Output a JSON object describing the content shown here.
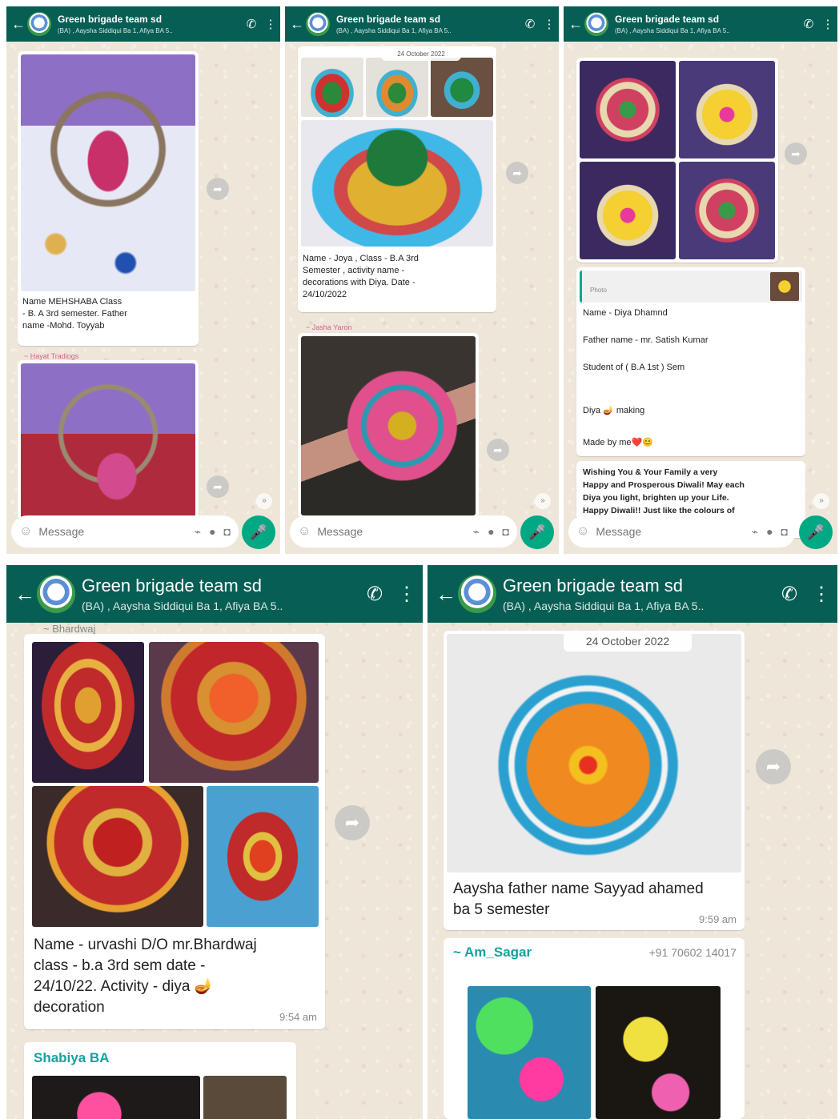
{
  "header": {
    "title": "Green brigade team sd",
    "subtitle": "(BA) , Aaysha Siddiqui Ba 1, Afiya BA 5.."
  },
  "input": {
    "placeholder": "Message"
  },
  "colors": {
    "header": "#075e54",
    "accent": "#00a884",
    "chat_bg": "#efe6da"
  },
  "icons": [
    "back-arrow-icon",
    "group-avatar",
    "call-icon",
    "menu-icon",
    "emoji-icon",
    "attach-icon",
    "payment-icon",
    "camera-icon",
    "mic-icon",
    "forward-icon"
  ],
  "panel1": {
    "caption": "Name MEHSHABA             Class\n- B. A 3rd semester.   Father\nname -Mohd. Toyyab",
    "sender": "~ Hayat Tradings"
  },
  "panel2": {
    "date": "24 October 2022",
    "caption": "Name - Joya , Class - B.A 3rd\nSemester , activity name -\ndecorations with Diya.          Date -\n24/10/2022",
    "sender": "~ Jasha Yaron"
  },
  "panel3": {
    "quote_label": "Photo",
    "lines": [
      "Name - Diya Dhamnd",
      "Father name - mr. Satish Kumar",
      "Student of ( B.A 1st ) Sem",
      "Diya 🪔 making",
      "Made by me❤️😊"
    ],
    "greeting": "Wishing You & Your Family a very\nHappy and Prosperous Diwali! May each\nDiya you light, brighten up your Life.\nHappy Diwali!! Just like the colours of"
  },
  "panel4": {
    "sender_top": "~ Bhardwaj",
    "caption": "Name - urvashi D/O  mr.Bhardwaj\nclass - b.a 3rd sem               date -\n24/10/22.                   Activity - diya 🪔\ndecoration",
    "time": "9:54 am",
    "sender2": "Shabiya BA"
  },
  "panel5": {
    "date": "24 October 2022",
    "caption": "Aaysha father name Sayyad ahamed\nba 5 semester",
    "time": "9:59 am",
    "sender": "~ Am_Sagar",
    "phone": "+91 70602 14017"
  }
}
